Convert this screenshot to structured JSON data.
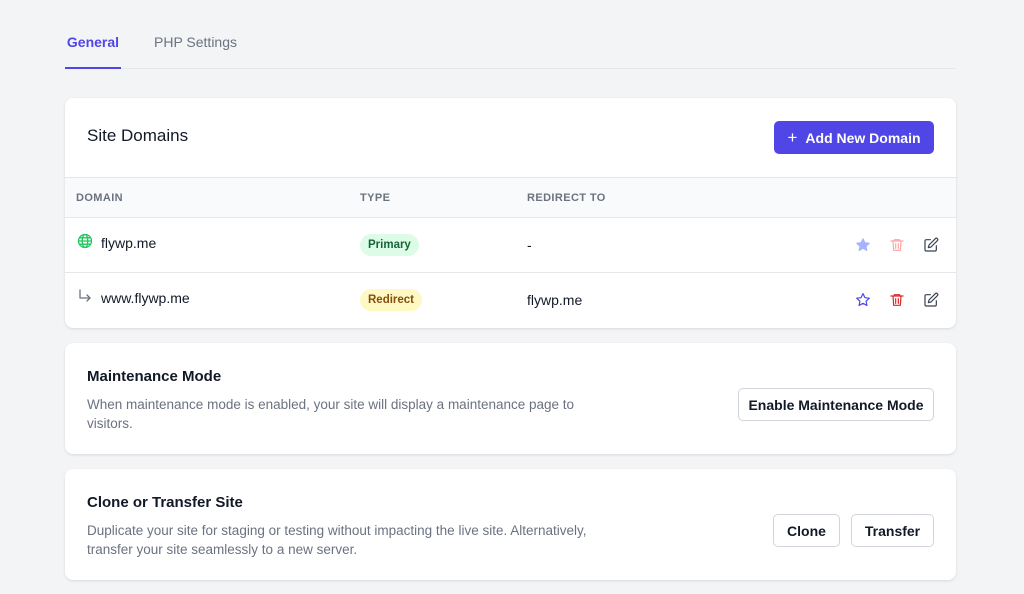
{
  "tabs": [
    {
      "label": "General",
      "active": true
    },
    {
      "label": "PHP Settings",
      "active": false
    }
  ],
  "domains_card": {
    "title": "Site Domains",
    "add_button": "Add New Domain",
    "columns": [
      "DOMAIN",
      "TYPE",
      "REDIRECT TO"
    ],
    "rows": [
      {
        "domain": "flywp.me",
        "type": "Primary",
        "redirect_to": "-",
        "icon": "globe-icon"
      },
      {
        "domain": "www.flywp.me",
        "type": "Redirect",
        "redirect_to": "flywp.me",
        "icon": "redirect-arrow-icon"
      }
    ]
  },
  "maintenance_card": {
    "title": "Maintenance Mode",
    "description": "When maintenance mode is enabled, your site will display a maintenance page to visitors.",
    "button": "Enable Maintenance Mode"
  },
  "clone_card": {
    "title": "Clone or Transfer Site",
    "description": "Duplicate your site for staging or testing without impacting the live site. Alternatively, transfer your site seamlessly to a new server.",
    "clone_button": "Clone",
    "transfer_button": "Transfer"
  },
  "colors": {
    "accent": "#4f46e5",
    "primary_badge_bg": "#dcfce7",
    "redirect_badge_bg": "#fef9c3",
    "delete_red": "#dc2626"
  }
}
